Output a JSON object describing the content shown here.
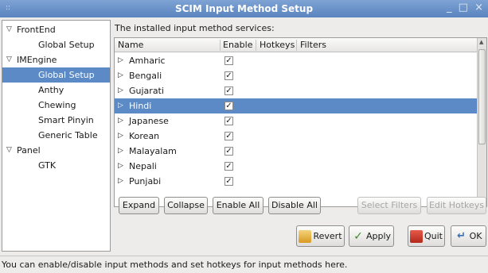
{
  "window": {
    "title": "SCIM Input Method Setup",
    "menu_glyph": "::",
    "controls": "_ □ ×"
  },
  "sidebar": {
    "items": [
      {
        "label": "FrontEnd",
        "level": 0,
        "expanded": true
      },
      {
        "label": "Global Setup",
        "level": 1
      },
      {
        "label": "IMEngine",
        "level": 0,
        "expanded": true
      },
      {
        "label": "Global Setup",
        "level": 1,
        "selected": true
      },
      {
        "label": "Anthy",
        "level": 1
      },
      {
        "label": "Chewing",
        "level": 1
      },
      {
        "label": "Smart Pinyin",
        "level": 1
      },
      {
        "label": "Generic Table",
        "level": 1
      },
      {
        "label": "Panel",
        "level": 0,
        "expanded": true
      },
      {
        "label": "GTK",
        "level": 1
      }
    ]
  },
  "services": {
    "label": "The installed input method services:",
    "columns": {
      "name": "Name",
      "enable": "Enable",
      "hotkeys": "Hotkeys",
      "filters": "Filters"
    },
    "rows": [
      {
        "name": "Amharic",
        "enabled": true
      },
      {
        "name": "Bengali",
        "enabled": true
      },
      {
        "name": "Gujarati",
        "enabled": true
      },
      {
        "name": "Hindi",
        "enabled": true,
        "selected": true
      },
      {
        "name": "Japanese",
        "enabled": true
      },
      {
        "name": "Korean",
        "enabled": true
      },
      {
        "name": "Malayalam",
        "enabled": true
      },
      {
        "name": "Nepali",
        "enabled": true
      },
      {
        "name": "Punjabi",
        "enabled": true
      }
    ]
  },
  "list_buttons": {
    "expand": "Expand",
    "collapse": "Collapse",
    "enable_all": "Enable All",
    "disable_all": "Disable All",
    "select_filters": "Select Filters",
    "edit_hotkeys": "Edit Hotkeys"
  },
  "dialog_buttons": {
    "revert": "Revert",
    "apply": "Apply",
    "quit": "Quit",
    "ok": "OK"
  },
  "status": "You can enable/disable input methods and set hotkeys for input methods here.",
  "colors": {
    "selection": "#5b8ac6",
    "titlebar": "#6b93c9",
    "window_bg": "#edeceb"
  }
}
